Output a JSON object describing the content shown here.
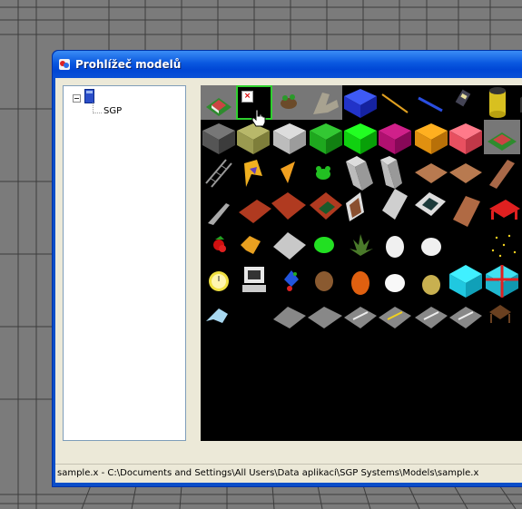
{
  "window": {
    "title": "Prohlížeč modelů",
    "colors": {
      "titlebar": "#0a58e0",
      "client": "#ece9d8",
      "selection": "#2fd02f"
    }
  },
  "tree": {
    "expander_state": "collapsed-minus",
    "root_icon": "document-icon",
    "items": [
      {
        "label": "SGP"
      }
    ]
  },
  "thumbnails": [
    [
      "house-model",
      "empty-selected",
      "plant-pot",
      "tree-trunk",
      "blue-cube",
      "stick",
      "pen",
      "can",
      "barrel",
      "partial"
    ],
    [
      "dark-grey-cube",
      "olive-cube",
      "light-grey-cube",
      "green-cube",
      "bright-green-cube",
      "magenta-cube",
      "orange-cube",
      "pink-cube",
      "house-model-2"
    ],
    [
      "ladder",
      "flag-yellow",
      "flag-orange",
      "frog",
      "pillar-grey",
      "pillar-grey-2",
      "floor-tile",
      "floor-tile-2",
      "floor-tile-3"
    ],
    [
      "plank",
      "bricks-red",
      "bricks-red-2",
      "window-green",
      "door-brown",
      "panel-grey",
      "window-dark",
      "wood-panel",
      "red-bench"
    ],
    [
      "strawberry",
      "leaf-yellow",
      "plate-grey",
      "green-blob",
      "palm-tree",
      "cloud-white",
      "cloud-white-2",
      "moon",
      "stars"
    ],
    [
      "clock",
      "computer",
      "toy",
      "rock",
      "orange-blob",
      "white-disc",
      "sack",
      "cyan-cube",
      "gift-box"
    ],
    [
      "bird",
      "road-grey",
      "road-grey-2",
      "road-stripe",
      "road-yellow-stripe",
      "road-stripe-2",
      "road-stripe-3",
      "basket"
    ]
  ],
  "selected_thumbnail": "empty-selected",
  "status": {
    "text": "sample.x - C:\\Documents and Settings\\All Users\\Data aplikací\\SGP Systems\\Models\\sample.x"
  }
}
